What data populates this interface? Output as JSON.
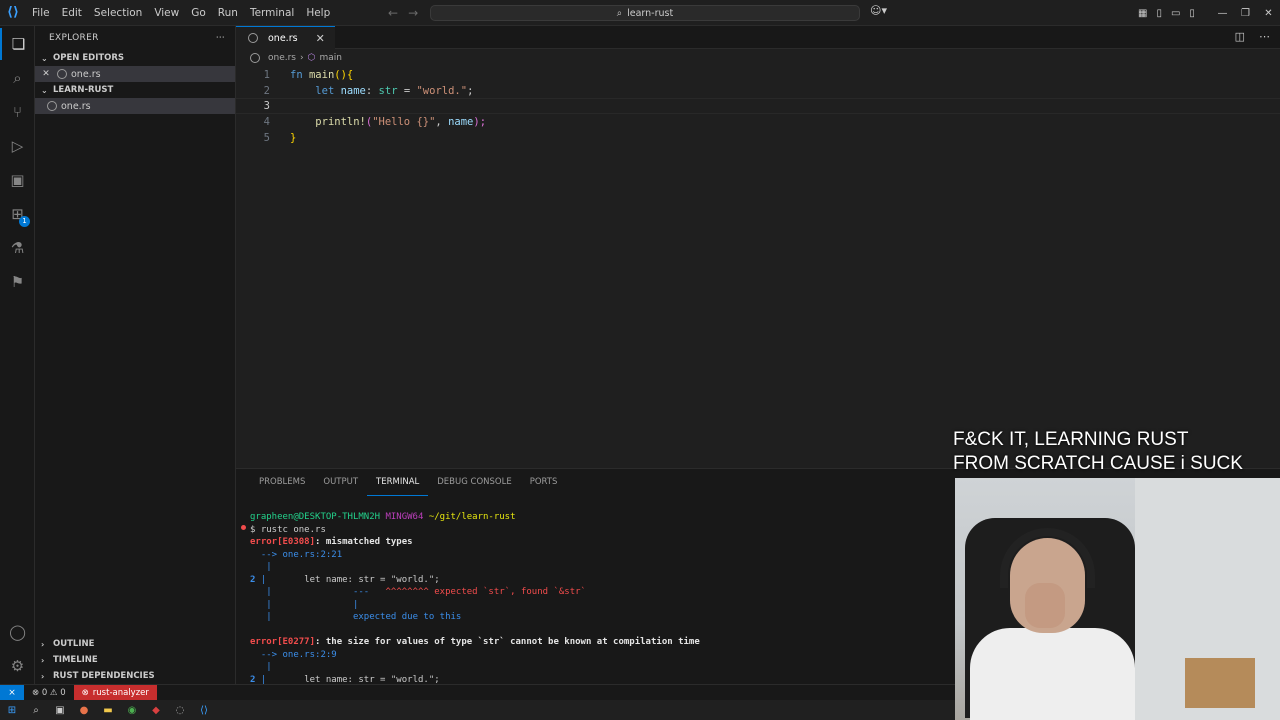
{
  "titlebar": {
    "menu": [
      "File",
      "Edit",
      "Selection",
      "View",
      "Go",
      "Run",
      "Terminal",
      "Help"
    ],
    "search_text": "learn-rust"
  },
  "sidebar": {
    "title": "EXPLORER",
    "open_editors_label": "OPEN EDITORS",
    "open_editor_file": "one.rs",
    "folder_label": "LEARN-RUST",
    "folder_file": "one.rs",
    "outline_label": "OUTLINE",
    "timeline_label": "TIMELINE",
    "rust_deps_label": "RUST DEPENDENCIES"
  },
  "activity": {
    "extensions_badge": "1"
  },
  "editor": {
    "tab_label": "one.rs",
    "breadcrumb_file": "one.rs",
    "breadcrumb_symbol": "main",
    "line_numbers": [
      "1",
      "2",
      "3",
      "4",
      "5"
    ],
    "code": {
      "l1_kw": "fn",
      "l1_fn": "main",
      "l1_rest": "(){",
      "l2_kw": "let",
      "l2_var": "name",
      "l2_colon": ": ",
      "l2_ty": "str",
      "l2_eq": " = ",
      "l2_str": "\"world.\"",
      "l2_end": ";",
      "l4_fn": "println!",
      "l4_open": "(",
      "l4_str": "\"Hello {}\"",
      "l4_comma": ", ",
      "l4_var": "name",
      "l4_close": ");",
      "l5": "}"
    }
  },
  "panel": {
    "tabs": [
      "PROBLEMS",
      "OUTPUT",
      "TERMINAL",
      "DEBUG CONSOLE",
      "PORTS"
    ],
    "active_tab": "TERMINAL",
    "terminal": {
      "prompt_user": "grapheen@DESKTOP-THLMN2H",
      "prompt_shell": "MINGW64",
      "prompt_path": "~/git/learn-rust",
      "command": "$ rustc one.rs",
      "err1_code": "error[E0308]",
      "err1_msg": ": mismatched types",
      "err1_loc": "  --> one.rs:2:21",
      "bar": "   |",
      "err1_line_no": "2",
      "err1_src": "       let name: str = \"world.\";",
      "err1_markers_a": "               ---   ",
      "err1_markers_b": "^^^^^^^^ expected `str`, found `&str`",
      "err1_pipe": "               |",
      "err1_note": "               expected due to this",
      "err2_code": "error[E0277]",
      "err2_msg": ": the size for values of type `str` cannot be known at compilation time",
      "err2_loc": "  --> one.rs:2:9",
      "err2_line_no": "2",
      "err2_src": "       let name: str = \"world.\";"
    }
  },
  "overlay": {
    "caption_line1": "F&CK IT, LEARNING RUST",
    "caption_line2": "FROM SCRATCH CAUSE i SUCK"
  },
  "statusbar": {
    "problems": "⊗ 0 ⚠ 0",
    "rust_analyzer": "rust-analyzer"
  },
  "colors": {
    "accent": "#0078d4",
    "error_bg": "#c72e2e"
  }
}
